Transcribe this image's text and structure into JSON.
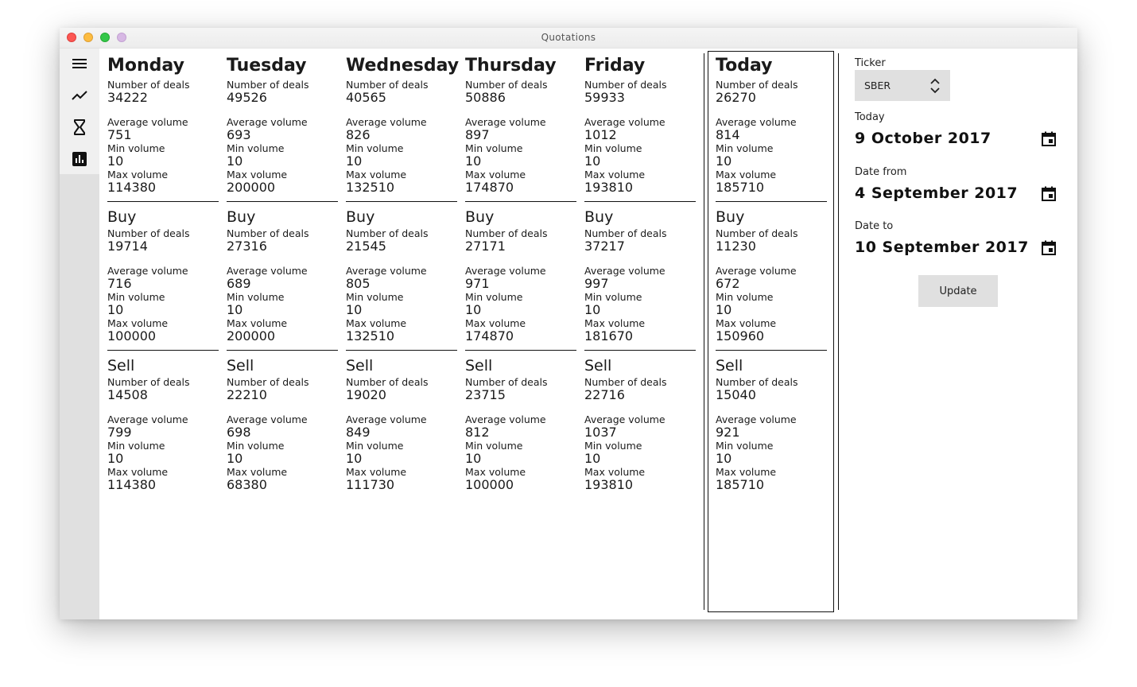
{
  "window": {
    "title": "Quotations"
  },
  "labels": {
    "deals": "Number of deals",
    "avg": "Average volume",
    "min": "Min volume",
    "max": "Max volume",
    "buy": "Buy",
    "sell": "Sell"
  },
  "sidebar": {
    "items": [
      {
        "icon": "menu-icon"
      },
      {
        "icon": "trend-line-icon"
      },
      {
        "icon": "hourglass-icon"
      },
      {
        "icon": "bar-chart-icon"
      }
    ]
  },
  "days": [
    {
      "name": "Monday",
      "all": {
        "deals": "34222",
        "avg": "751",
        "min": "10",
        "max": "114380"
      },
      "buy": {
        "deals": "19714",
        "avg": "716",
        "min": "10",
        "max": "100000"
      },
      "sell": {
        "deals": "14508",
        "avg": "799",
        "min": "10",
        "max": "114380"
      }
    },
    {
      "name": "Tuesday",
      "all": {
        "deals": "49526",
        "avg": "693",
        "min": "10",
        "max": "200000"
      },
      "buy": {
        "deals": "27316",
        "avg": "689",
        "min": "10",
        "max": "200000"
      },
      "sell": {
        "deals": "22210",
        "avg": "698",
        "min": "10",
        "max": "68380"
      }
    },
    {
      "name": "Wednesday",
      "all": {
        "deals": "40565",
        "avg": "826",
        "min": "10",
        "max": "132510"
      },
      "buy": {
        "deals": "21545",
        "avg": "805",
        "min": "10",
        "max": "132510"
      },
      "sell": {
        "deals": "19020",
        "avg": "849",
        "min": "10",
        "max": "111730"
      }
    },
    {
      "name": "Thursday",
      "all": {
        "deals": "50886",
        "avg": "897",
        "min": "10",
        "max": "174870"
      },
      "buy": {
        "deals": "27171",
        "avg": "971",
        "min": "10",
        "max": "174870"
      },
      "sell": {
        "deals": "23715",
        "avg": "812",
        "min": "10",
        "max": "100000"
      }
    },
    {
      "name": "Friday",
      "all": {
        "deals": "59933",
        "avg": "1012",
        "min": "10",
        "max": "193810"
      },
      "buy": {
        "deals": "37217",
        "avg": "997",
        "min": "10",
        "max": "181670"
      },
      "sell": {
        "deals": "22716",
        "avg": "1037",
        "min": "10",
        "max": "193810"
      }
    },
    {
      "name": "Today",
      "all": {
        "deals": "26270",
        "avg": "814",
        "min": "10",
        "max": "185710"
      },
      "buy": {
        "deals": "11230",
        "avg": "672",
        "min": "10",
        "max": "150960"
      },
      "sell": {
        "deals": "15040",
        "avg": "921",
        "min": "10",
        "max": "185710"
      }
    }
  ],
  "panel": {
    "ticker_label": "Ticker",
    "ticker_value": "SBER",
    "today_label": "Today",
    "today_value": "9 October 2017",
    "from_label": "Date from",
    "from_value": "4 September 2017",
    "to_label": "Date to",
    "to_value": "10 September 2017",
    "update_label": "Update"
  }
}
